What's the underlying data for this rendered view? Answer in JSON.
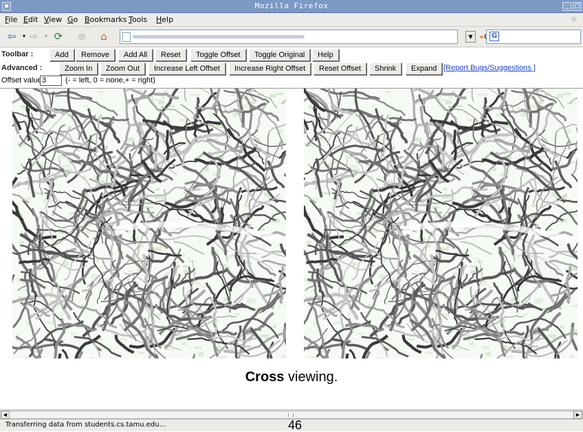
{
  "window": {
    "title": "Mozilla Firefox"
  },
  "menu": [
    {
      "label": "File",
      "u": "F",
      "rest": "ile"
    },
    {
      "label": "Edit",
      "u": "E",
      "rest": "dit"
    },
    {
      "label": "View",
      "u": "V",
      "rest": "iew"
    },
    {
      "label": "Go",
      "u": "G",
      "rest": "o"
    },
    {
      "label": "Bookmarks",
      "u": "B",
      "rest": "ookmarks"
    },
    {
      "label": "Tools",
      "u": "T",
      "rest": "ools"
    },
    {
      "label": "Help",
      "u": "H",
      "rest": "elp"
    }
  ],
  "nav": {
    "go_label": "Go"
  },
  "toolbar": {
    "label": "Toolbar :",
    "buttons": [
      "Add",
      "Remove",
      "Add All",
      "Reset",
      "Toggle Offset",
      "Toggle Original",
      "Help"
    ]
  },
  "advanced": {
    "label": "Advanced :",
    "buttons": [
      "Zoom In",
      "Zoom Out",
      "Increase Left Offset",
      "Increase Right Offset",
      "Reset Offset",
      "Shrink",
      "Expand"
    ],
    "report_link": "[Report Bugs/Suggestions ]"
  },
  "offset": {
    "label": "Offset value:",
    "value": "3",
    "hint": "(- = left, 0 = none,+ = right)"
  },
  "caption": {
    "bold": "Cross",
    "rest": " viewing."
  },
  "status": {
    "text": "Transferring data from students.cs.tamu.edu..."
  },
  "page_number": "46",
  "colors": {
    "titlebar": "#7c98c4",
    "chrome": "#ecebe8",
    "link": "#1a3fd1",
    "vessel_dark": "#3a3a3a",
    "vessel_mid": "#8d8d8d",
    "background_tint": "#dbe8d6"
  },
  "icons": [
    "back-icon",
    "forward-icon",
    "reload-icon",
    "stop-icon",
    "home-icon",
    "page-icon",
    "dropdown-icon",
    "go-icon",
    "google-icon"
  ]
}
